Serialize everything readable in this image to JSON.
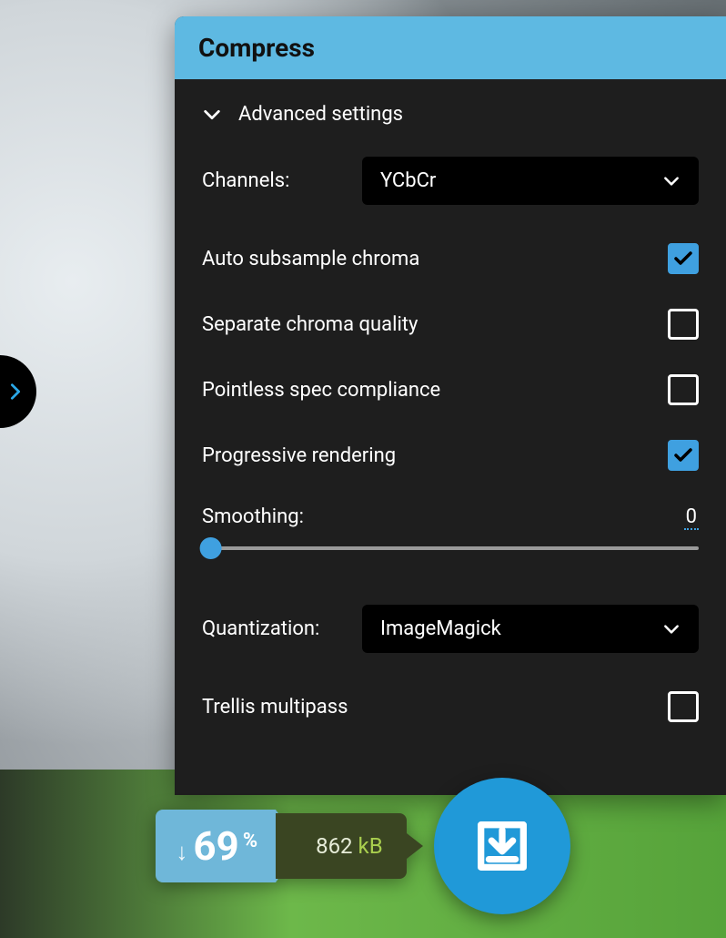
{
  "panel": {
    "title": "Compress",
    "advanced_label": "Advanced settings"
  },
  "channels": {
    "label": "Channels:",
    "value": "YCbCr"
  },
  "options": {
    "auto_subsample": {
      "label": "Auto subsample chroma",
      "checked": true
    },
    "sep_chroma": {
      "label": "Separate chroma quality",
      "checked": false
    },
    "spec_compl": {
      "label": "Pointless spec compliance",
      "checked": false
    },
    "progressive": {
      "label": "Progressive rendering",
      "checked": true
    },
    "trellis": {
      "label": "Trellis multipass",
      "checked": false
    }
  },
  "smoothing": {
    "label": "Smoothing:",
    "value": "0"
  },
  "quantization": {
    "label": "Quantization:",
    "value": "ImageMagick"
  },
  "result": {
    "savings_pct": "69",
    "savings_pct_sym": "%",
    "size_value": "862",
    "size_unit": "kB"
  }
}
